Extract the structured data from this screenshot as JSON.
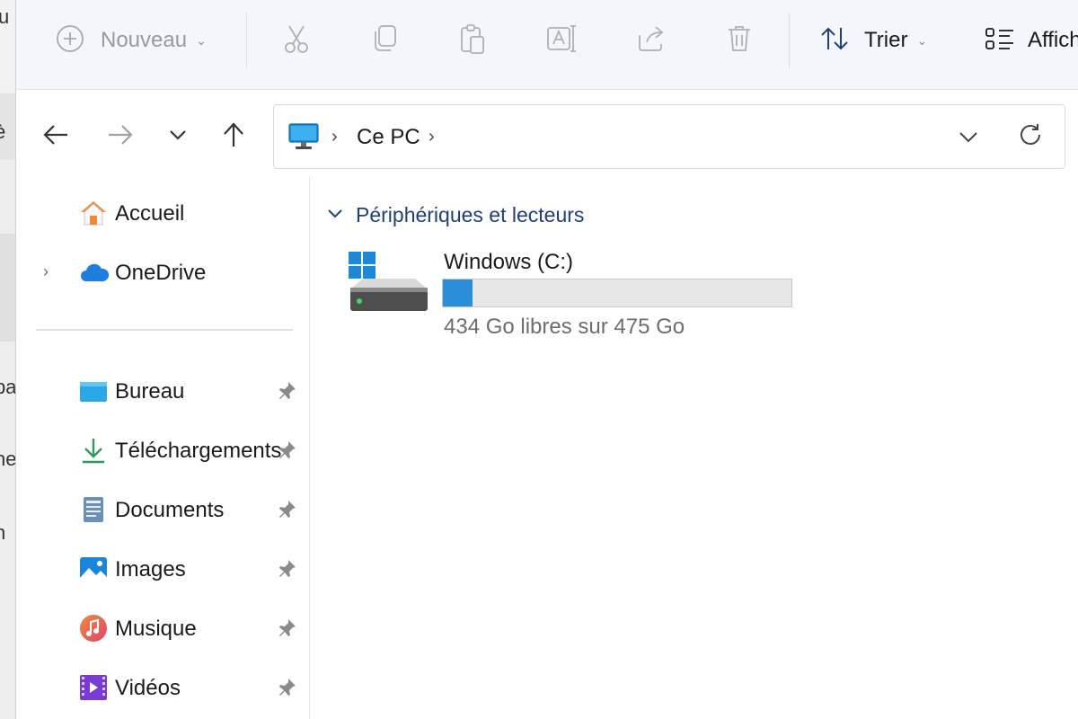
{
  "background_window": {
    "fragments": [
      "u",
      "è",
      "pa",
      "ne",
      "n"
    ]
  },
  "toolbar": {
    "new_label": "Nouveau",
    "sort_label": "Trier",
    "view_label": "Affich",
    "icons": [
      "new-plus-icon",
      "cut-icon",
      "copy-icon",
      "paste-icon",
      "rename-icon",
      "share-icon",
      "delete-icon",
      "sort-icon",
      "view-icon"
    ]
  },
  "navigation": {
    "icons": [
      "back-arrow-icon",
      "forward-arrow-icon",
      "recent-dropdown-icon",
      "up-arrow-icon"
    ]
  },
  "address_bar": {
    "crumb": "Ce PC",
    "separator": "›"
  },
  "sidebar": {
    "top_items": [
      {
        "label": "Accueil",
        "icon": "home-icon"
      },
      {
        "label": "OneDrive",
        "icon": "onedrive-cloud-icon",
        "expander": "›"
      }
    ],
    "pinned_items": [
      {
        "label": "Bureau",
        "icon": "desktop-folder-icon"
      },
      {
        "label": "Téléchargements",
        "icon": "downloads-icon"
      },
      {
        "label": "Documents",
        "icon": "documents-icon"
      },
      {
        "label": "Images",
        "icon": "pictures-icon"
      },
      {
        "label": "Musique",
        "icon": "music-icon"
      },
      {
        "label": "Vidéos",
        "icon": "videos-icon"
      }
    ]
  },
  "content": {
    "group_header": "Périphériques et lecteurs",
    "drives": [
      {
        "name": "Windows (C:)",
        "free_text": "434 Go libres sur 475 Go",
        "used_fraction": 0.086
      }
    ]
  },
  "colors": {
    "accent": "#2a8fd8",
    "group_header": "#1f3f7a",
    "toolbar_bg": "#f3f6fb"
  }
}
